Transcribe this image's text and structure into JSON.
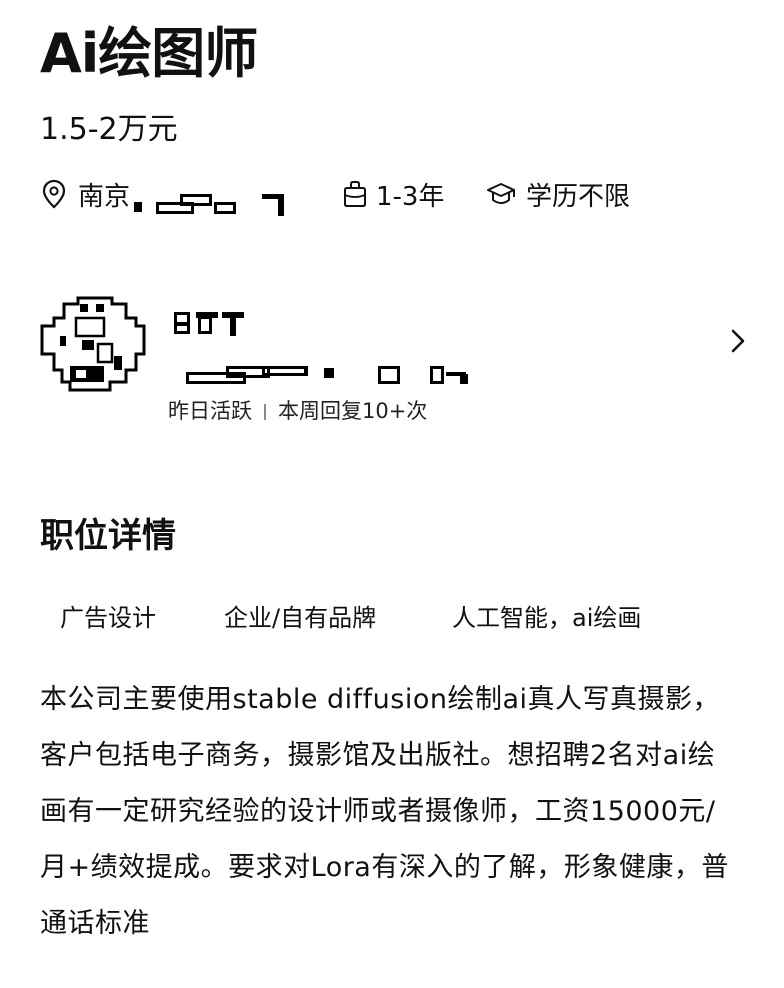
{
  "job": {
    "title": "Ai绘图师",
    "salary": "1.5-2万元",
    "location": "南京",
    "experience": "1-3年",
    "education": "学历不限"
  },
  "recruiter": {
    "activity": "昨日活跃",
    "reply_rate": "本周回复10+次"
  },
  "details": {
    "section_title": "职位详情",
    "tags": [
      "广告设计",
      "企业/自有品牌",
      "人工智能，ai绘画"
    ],
    "description": "本公司主要使用stable diffusion绘制ai真人写真摄影，客户包括电子商务，摄影馆及出版社。想招聘2名对ai绘画有一定研究经验的设计师或者摄像师，工资15000元/月+绩效提成。要求对Lora有深入的了解，形象健康，普通话标准"
  },
  "icons": {
    "location": "location-pin-icon",
    "experience": "briefcase-icon",
    "education": "graduation-cap-icon",
    "chevron": "chevron-right-icon"
  }
}
